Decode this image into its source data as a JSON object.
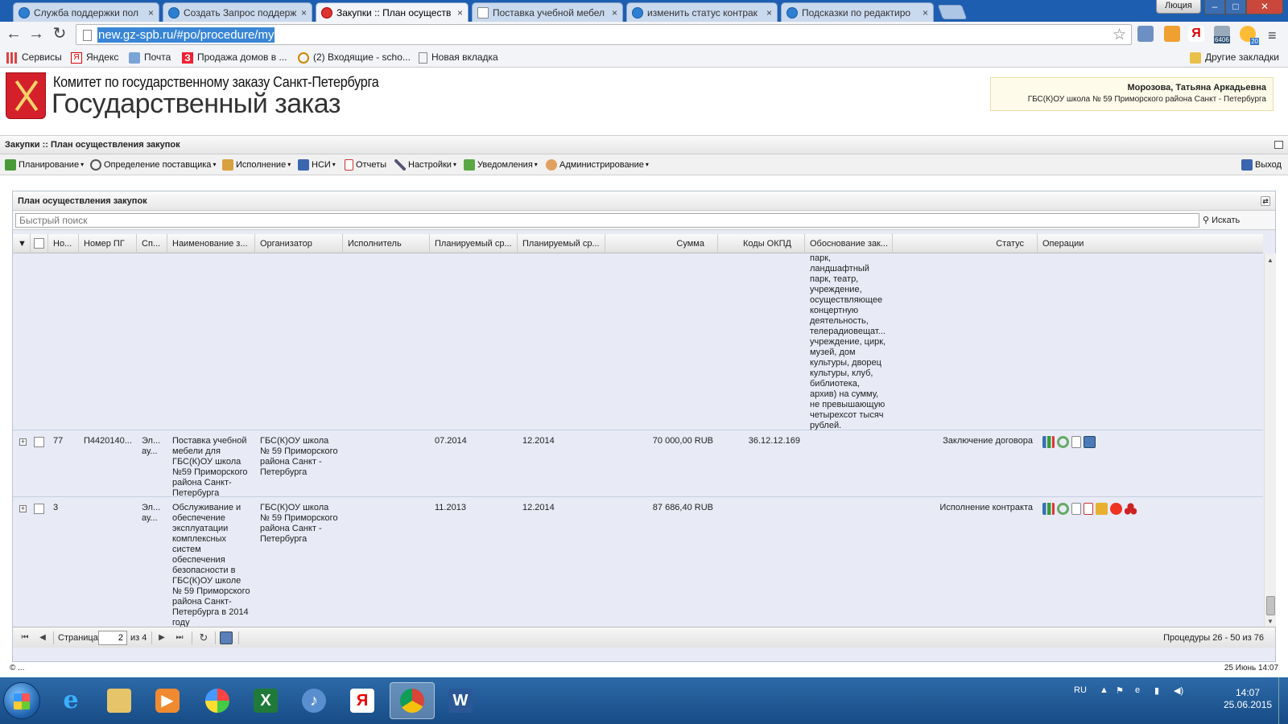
{
  "browser": {
    "tabs": [
      {
        "title": "Служба поддержки пол",
        "close": "×",
        "icon": "support-icon"
      },
      {
        "title": "Создать Запрос поддерж",
        "close": "×",
        "icon": "support-icon"
      },
      {
        "title": "Закупки :: План осуществ",
        "close": "×",
        "icon": "gz-icon",
        "active": true
      },
      {
        "title": "Поставка учебной мебел",
        "close": "×",
        "icon": "page-icon"
      },
      {
        "title": "изменить статус контрак",
        "close": "×",
        "icon": "help-icon"
      },
      {
        "title": "Подсказки по редактиро",
        "close": "×",
        "icon": "help-icon"
      }
    ],
    "user": "Люция",
    "window_controls": {
      "minimize": "–",
      "maximize": "□",
      "close": "✕"
    },
    "nav": {
      "back": "←",
      "forward": "→",
      "reload": "↻"
    },
    "url": "new.gz-spb.ru/#po/procedure/my",
    "star": "☆",
    "menu": "≡",
    "extensions": [
      {
        "icon": "extension-icon-blue"
      },
      {
        "icon": "extension-icon-orange"
      },
      {
        "icon": "yandex-icon",
        "label": "Я"
      },
      {
        "icon": "mail-icon",
        "badge": "6406"
      },
      {
        "icon": "weather-icon",
        "badge": "20"
      }
    ],
    "bookmarks": [
      {
        "label": "Сервисы",
        "icon": "apps-icon"
      },
      {
        "label": "Яндекс",
        "icon": "yandex-icon"
      },
      {
        "label": "Почта",
        "icon": "mail-icon"
      },
      {
        "label": "Продажа домов в ...",
        "icon": "z-icon"
      },
      {
        "label": "(2) Входящие - scho...",
        "icon": "inbox-icon"
      },
      {
        "label": "Новая вкладка",
        "icon": "page-icon"
      }
    ],
    "other_bookmarks": "Другие закладки"
  },
  "header": {
    "org": "Комитет по государственному заказу Санкт-Петербурга",
    "product": "Государственный заказ",
    "user_name": "Морозова, Татьяна Аркадьевна",
    "user_org": "ГБС(К)ОУ школа № 59 Приморского района Санкт - Петербурга"
  },
  "app": {
    "title": "Закупки :: План осуществления закупок",
    "menu": [
      {
        "label": "Планирование",
        "dropdown": true
      },
      {
        "label": "Определение поставщика",
        "dropdown": true
      },
      {
        "label": "Исполнение",
        "dropdown": true
      },
      {
        "label": "НСИ",
        "dropdown": true
      },
      {
        "label": "Отчеты",
        "dropdown": false
      },
      {
        "label": "Настройки",
        "dropdown": true
      },
      {
        "label": "Уведомления",
        "dropdown": true
      },
      {
        "label": "Администрирование",
        "dropdown": true
      }
    ],
    "caret": "▾",
    "exit": "Выход"
  },
  "grid": {
    "title": "План осуществления закупок",
    "refresh": "⇄",
    "search_placeholder": "Быстрый поиск",
    "search_button": "Искать",
    "columns": [
      "Но...",
      "Номер ПГ",
      "Сп...",
      "Наименование з...",
      "Организатор",
      "Исполнитель",
      "Планируемый ср...",
      "Планируемый ср...",
      "Сумма",
      "Коды ОКПД",
      "Обоснование зак...",
      "Статус",
      "Операции"
    ],
    "partial_row_text": "парк, ландшафтный парк, театр, учреждение, осуществляющее концертную деятельность, телерадиовещат... учреждение, цирк, музей, дом культуры, дворец культуры, клуб, библиотека, архив) на сумму, не превышающую четырехсот тысяч рублей.",
    "rows": [
      {
        "no": "77",
        "pg": "П4420140...",
        "sp": "Эл... ау...",
        "name": "Поставка учебной мебели для ГБС(К)ОУ школа №59 Приморского района Санкт-Петербурга",
        "organizer": "ГБС(К)ОУ школа № 59 Приморского района Санкт - Петербурга",
        "executor": "",
        "date1": "07.2014",
        "date2": "12.2014",
        "sum": "70 000,00 RUB",
        "okpd": "36.12.12.169",
        "basis": "",
        "status": "Заключение договора",
        "ops": [
          "chart-icon",
          "settings-icon",
          "document-icon",
          "calculator-icon"
        ]
      },
      {
        "no": "3",
        "pg": "",
        "sp": "Эл... ау...",
        "name": "Обслуживание и обеспечение эксплуатации комплексных систем обеспечения безопасности в ГБС(К)ОУ школе № 59 Приморского района Санкт-Петербурга в 2014 году",
        "organizer": "ГБС(К)ОУ школа № 59 Приморского района Санкт - Петербурга",
        "executor": "",
        "date1": "11.2013",
        "date2": "12.2014",
        "sum": "87 686,40 RUB",
        "okpd": "",
        "basis": "",
        "status": "Исполнение контракта",
        "ops": [
          "chart-icon",
          "settings-icon",
          "document-icon",
          "report-icon",
          "edit-icon",
          "stop-icon",
          "users-icon"
        ]
      }
    ],
    "pager": {
      "first": "⏮",
      "prev": "◀",
      "next": "▶",
      "last": "⏭",
      "reload": "↻",
      "page_label": "Страница",
      "page": "2",
      "of": "из 4",
      "count": "Процедуры 26 - 50 из 76"
    }
  },
  "footer": {
    "copyright": "© ...",
    "datetime": "25 Июнь 14:07"
  },
  "taskbar": {
    "apps": [
      {
        "icon": "ie-icon",
        "label": "e"
      },
      {
        "icon": "explorer-icon",
        "label": ""
      },
      {
        "icon": "media-player-icon",
        "label": "▶"
      },
      {
        "icon": "paint-icon",
        "label": ""
      },
      {
        "icon": "excel-icon",
        "label": "X"
      },
      {
        "icon": "speaker-app-icon",
        "label": "♪"
      },
      {
        "icon": "yandex-browser-icon",
        "label": "Я"
      },
      {
        "icon": "chrome-icon",
        "label": "",
        "active": true
      },
      {
        "icon": "word-icon",
        "label": "W"
      }
    ],
    "lang": "RU",
    "time": "14:07",
    "date": "25.06.2015"
  },
  "colors": {
    "tab_strip": "#1d5eb0",
    "grid_bg": "#e8ebf6",
    "url_highlight": "#3a86d6",
    "logo_red": "#d4202a"
  }
}
